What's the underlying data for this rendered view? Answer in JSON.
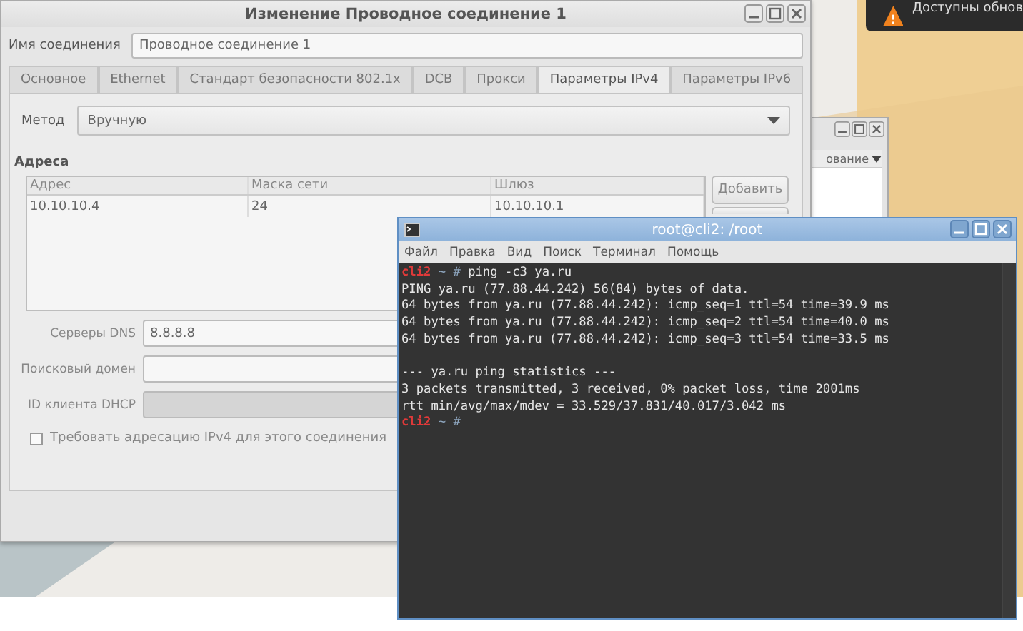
{
  "notification": {
    "text": "Доступны обнов"
  },
  "dialog": {
    "title": "Изменение Проводное соединение 1",
    "name_label": "Имя соединения",
    "name_value": "Проводное соединение 1",
    "tabs": [
      {
        "label": "Основное",
        "selected": false
      },
      {
        "label": "Ethernet",
        "selected": false
      },
      {
        "label": "Стандарт безопасности 802.1x",
        "selected": false
      },
      {
        "label": "DCB",
        "selected": false
      },
      {
        "label": "Прокси",
        "selected": false
      },
      {
        "label": "Параметры IPv4",
        "selected": true
      },
      {
        "label": "Параметры IPv6",
        "selected": false
      }
    ],
    "method": {
      "label": "Метод",
      "value": "Вручную"
    },
    "addresses": {
      "heading": "Адреса",
      "columns": [
        "Адрес",
        "Маска сети",
        "Шлюз"
      ],
      "rows": [
        [
          "10.10.10.4",
          "24",
          "10.10.10.1"
        ]
      ],
      "add_button": "Добавить"
    },
    "fields": [
      {
        "label": "Серверы DNS",
        "value": "8.8.8.8",
        "disabled": false
      },
      {
        "label": "Поисковый домен",
        "disabled": false
      },
      {
        "label": "ID клиента DHCP",
        "disabled": true
      }
    ],
    "checkbox": {
      "label": "Требовать адресацию IPv4 для этого соединения",
      "checked": false
    }
  },
  "background_window": {
    "column_header": "ование"
  },
  "terminal": {
    "title": "root@cli2: /root",
    "menu": [
      "Файл",
      "Правка",
      "Вид",
      "Поиск",
      "Терминал",
      "Помощь"
    ],
    "lines": [
      {
        "kind": "prompt",
        "host": "cli2",
        "path": "~ #",
        "command": "ping -c3 ya.ru"
      },
      {
        "kind": "output",
        "text": "PING ya.ru (77.88.44.242) 56(84) bytes of data."
      },
      {
        "kind": "output",
        "text": "64 bytes from ya.ru (77.88.44.242): icmp_seq=1 ttl=54 time=39.9 ms"
      },
      {
        "kind": "output",
        "text": "64 bytes from ya.ru (77.88.44.242): icmp_seq=2 ttl=54 time=40.0 ms"
      },
      {
        "kind": "output",
        "text": "64 bytes from ya.ru (77.88.44.242): icmp_seq=3 ttl=54 time=33.5 ms"
      },
      {
        "kind": "blank"
      },
      {
        "kind": "output",
        "text": "--- ya.ru ping statistics ---"
      },
      {
        "kind": "output",
        "text": "3 packets transmitted, 3 received, 0% packet loss, time 2001ms"
      },
      {
        "kind": "output",
        "text": "rtt min/avg/max/mdev = 33.529/37.831/40.017/3.042 ms"
      },
      {
        "kind": "prompt",
        "host": "cli2",
        "path": "~ #"
      }
    ]
  }
}
